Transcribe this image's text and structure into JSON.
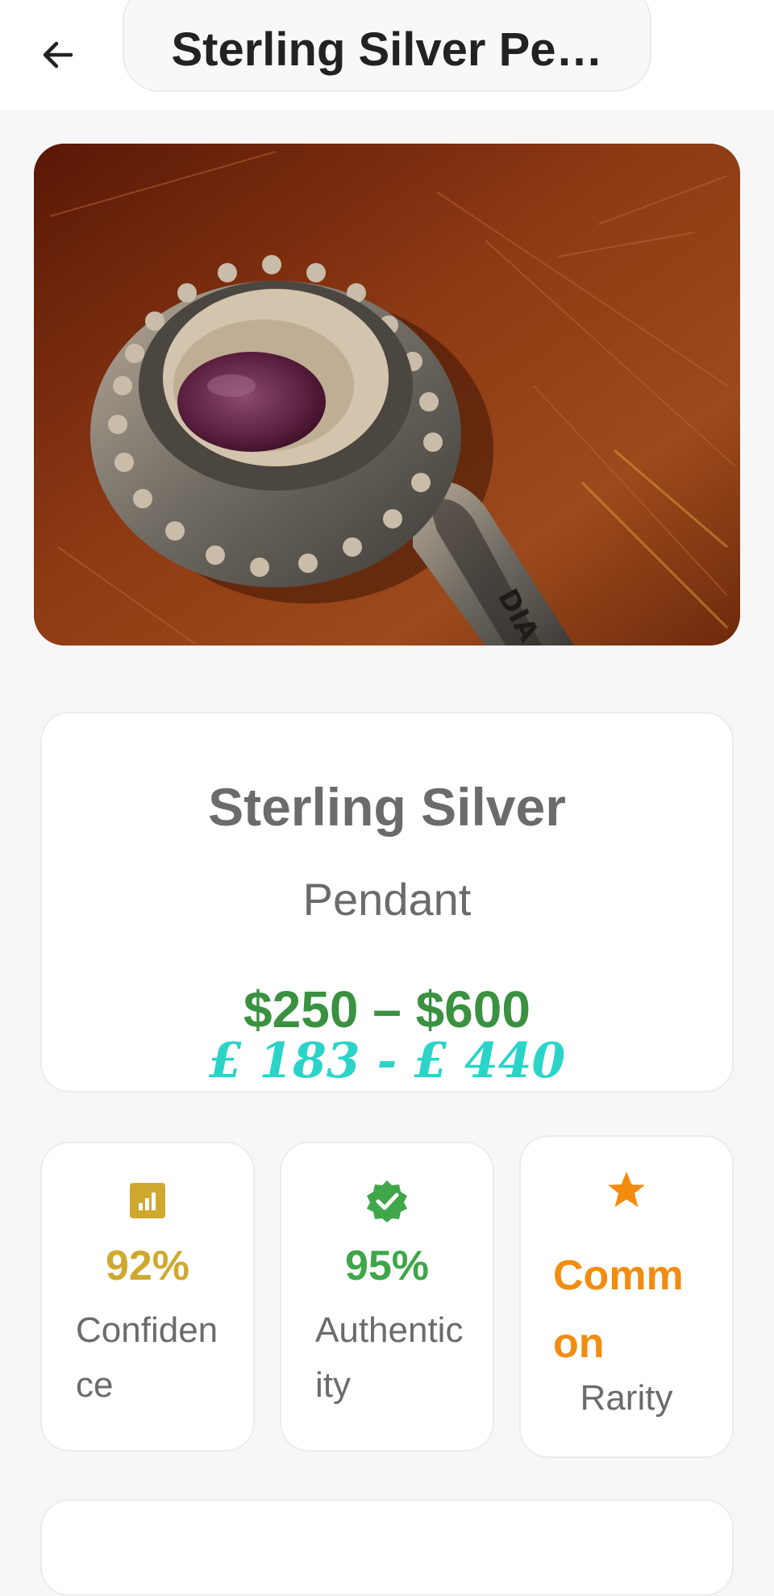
{
  "header": {
    "title": "Sterling Silver Pe…"
  },
  "photo": {
    "alt": "Sterling silver pendant with oval purple gemstone on wooden surface",
    "engraving": "DIA"
  },
  "valuation": {
    "name": "Sterling Silver",
    "type": "Pendant",
    "price_usd": "$250 – $600",
    "price_gbp": "£ 183 - £ 440"
  },
  "stats": {
    "confidence": {
      "value": "92%",
      "label": "Confidence",
      "color": "#cfa92f",
      "icon": "bar-chart-icon"
    },
    "authenticity": {
      "value": "95%",
      "label": "Authenticity",
      "color": "#3fa64a",
      "icon": "verified-badge-icon"
    },
    "rarity": {
      "value": "Common",
      "label": "Rarity",
      "color": "#f28c0f",
      "icon": "star-icon"
    }
  }
}
